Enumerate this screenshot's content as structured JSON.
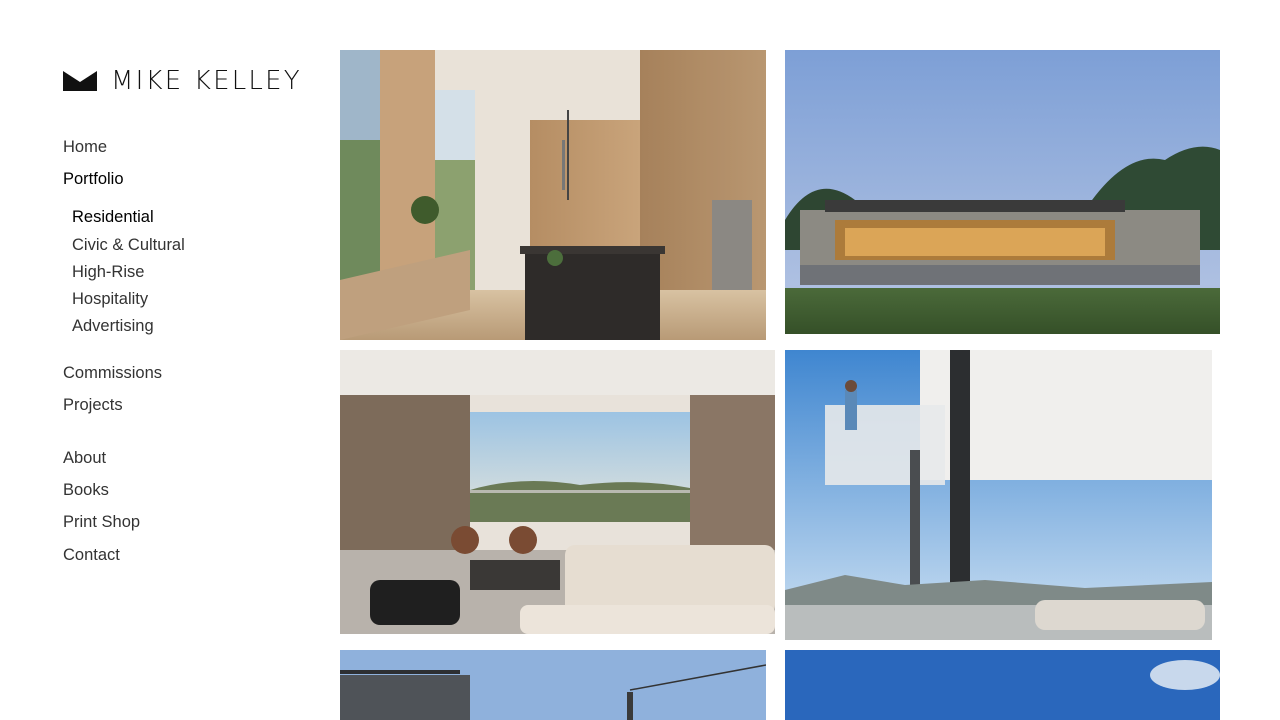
{
  "site": {
    "logo_text": "MIKE KELLEY",
    "logo_icon": "crown-mark-icon"
  },
  "nav": {
    "home": "Home",
    "portfolio": "Portfolio",
    "portfolio_sub": [
      "Residential",
      "Civic & Cultural",
      "High-Rise",
      "Hospitality",
      "Advertising"
    ],
    "commissions": "Commissions",
    "projects": "Projects",
    "about": "About",
    "books": "Books",
    "print_shop": "Print Shop",
    "contact": "Contact",
    "active_section": "Portfolio",
    "active_subsection": "Residential"
  },
  "gallery": {
    "images": [
      {
        "subject": "modern-kitchen-photo"
      },
      {
        "subject": "house-at-dusk-photo"
      },
      {
        "subject": "living-room-city-view-photo"
      },
      {
        "subject": "glass-house-balcony-photo"
      },
      {
        "subject": "house-rooftop-dusk-photo"
      },
      {
        "subject": "blue-sky-photo"
      }
    ]
  },
  "colors": {
    "text": "#333333",
    "active_text": "#000000",
    "background": "#ffffff"
  }
}
